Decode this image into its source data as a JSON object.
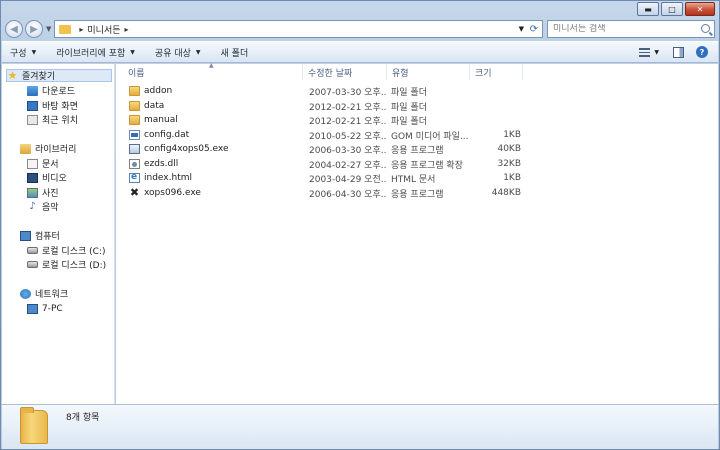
{
  "window": {
    "title": "",
    "caption": {
      "minimize": "▬",
      "maximize": "□",
      "close": "✕"
    }
  },
  "address": {
    "path": "미니서든",
    "separator_1": "▸",
    "separator_2": "▸",
    "refresh": "⟳",
    "dropdown": "▼"
  },
  "search": {
    "placeholder": "미니서든 검색"
  },
  "nav_buttons": {
    "back": "◀",
    "forward": "▶",
    "dropdown": "▼"
  },
  "toolbar": {
    "items": [
      {
        "label": "구성",
        "dropdown": true
      },
      {
        "label": "라이브러리에 포함",
        "dropdown": true
      },
      {
        "label": "공유 대상",
        "dropdown": true
      },
      {
        "label": "새 폴더",
        "dropdown": false
      }
    ],
    "dropdown_glyph": "▼",
    "help": "?"
  },
  "sidebar": {
    "favorites": {
      "label": "즐겨찾기",
      "items": [
        "다운로드",
        "바탕 화면",
        "최근 위치"
      ]
    },
    "libraries": {
      "label": "라이브러리",
      "items": [
        "문서",
        "비디오",
        "사진",
        "음악"
      ]
    },
    "computer": {
      "label": "컴퓨터",
      "items": [
        "로컬 디스크 (C:)",
        "로컬 디스크 (D:)"
      ]
    },
    "network": {
      "label": "네트워크",
      "items": [
        "7-PC"
      ]
    }
  },
  "columns": {
    "name": "이름",
    "date": "수정한 날짜",
    "type": "유형",
    "size": "크기"
  },
  "files": [
    {
      "name": "addon",
      "date": "2007-03-30 오후...",
      "type": "파일 폴더",
      "size": "",
      "icon": "folder-icon"
    },
    {
      "name": "data",
      "date": "2012-02-21 오후...",
      "type": "파일 폴더",
      "size": "",
      "icon": "folder-icon"
    },
    {
      "name": "manual",
      "date": "2012-02-21 오후...",
      "type": "파일 폴더",
      "size": "",
      "icon": "folder-icon"
    },
    {
      "name": "config.dat",
      "date": "2010-05-22 오후...",
      "type": "GOM 미디어 파일...",
      "size": "1KB",
      "icon": "dat-file-icon"
    },
    {
      "name": "config4xops05.exe",
      "date": "2006-03-30 오후...",
      "type": "응용 프로그램",
      "size": "40KB",
      "icon": "exe-file-icon"
    },
    {
      "name": "ezds.dll",
      "date": "2004-02-27 오후...",
      "type": "응용 프로그램 확장",
      "size": "32KB",
      "icon": "dll-file-icon"
    },
    {
      "name": "index.html",
      "date": "2003-04-29 오전...",
      "type": "HTML 문서",
      "size": "1KB",
      "icon": "html-file-icon"
    },
    {
      "name": "xops096.exe",
      "date": "2006-04-30 오후...",
      "type": "응용 프로그램",
      "size": "448KB",
      "icon": "xops-exe-icon"
    }
  ],
  "status": {
    "item_count": "8개 항목"
  },
  "glyphs": {
    "star": "★",
    "music": "♪",
    "xops": "✖",
    "sort_caret": "▲"
  }
}
